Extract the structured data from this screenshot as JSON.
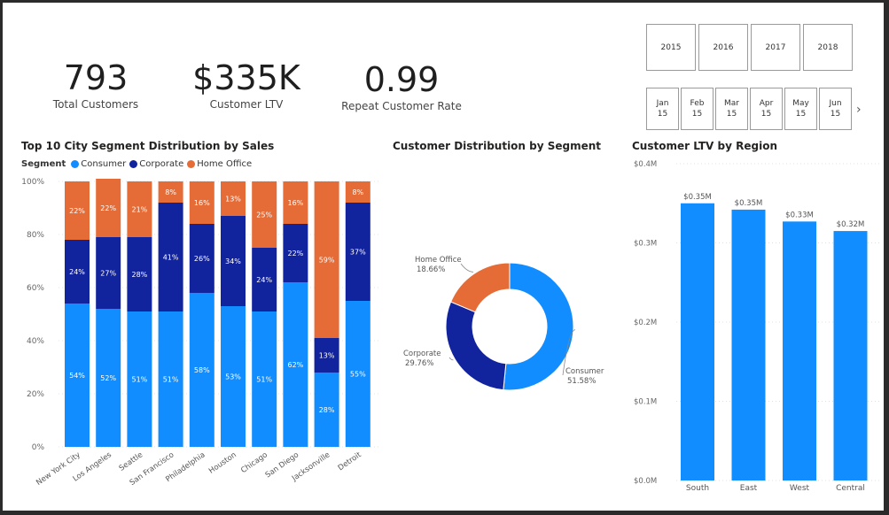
{
  "kpis": [
    {
      "value": "793",
      "label": "Total Customers"
    },
    {
      "value": "$335K",
      "label": "Customer LTV"
    },
    {
      "value": "0.99",
      "label": "Repeat Customer Rate"
    }
  ],
  "year_slicer": [
    "2015",
    "2016",
    "2017",
    "2018"
  ],
  "month_slicer": [
    {
      "month": "Jan",
      "year": "15"
    },
    {
      "month": "Feb",
      "year": "15"
    },
    {
      "month": "Mar",
      "year": "15"
    },
    {
      "month": "Apr",
      "year": "15"
    },
    {
      "month": "May",
      "year": "15"
    },
    {
      "month": "Jun",
      "year": "15"
    }
  ],
  "month_next_icon": "chevron-right-icon",
  "colors": {
    "consumer": "#118DFF",
    "corporate": "#12239E",
    "home_office": "#E66C37",
    "ltv_bar": "#118DFF"
  },
  "chart_data": [
    {
      "type": "bar",
      "stacking": "percent",
      "title": "Top 10 City Segment Distribution by Sales",
      "legend_title": "Segment",
      "legend_position": "top-left",
      "categories": [
        "New York City",
        "Los Angeles",
        "Seattle",
        "San Francisco",
        "Philadelphia",
        "Houston",
        "Chicago",
        "San Diego",
        "Jacksonville",
        "Detroit"
      ],
      "series": [
        {
          "name": "Consumer",
          "values": [
            54,
            52,
            51,
            51,
            58,
            53,
            51,
            62,
            28,
            55
          ]
        },
        {
          "name": "Corporate",
          "values": [
            24,
            27,
            28,
            41,
            26,
            34,
            24,
            22,
            13,
            37
          ]
        },
        {
          "name": "Home Office",
          "values": [
            22,
            22,
            21,
            8,
            16,
            13,
            25,
            16,
            59,
            8
          ]
        }
      ],
      "yticks": [
        "0%",
        "20%",
        "40%",
        "60%",
        "80%",
        "100%"
      ],
      "ylim": [
        0,
        100
      ]
    },
    {
      "type": "pie",
      "donut": true,
      "title": "Customer Distribution by Segment",
      "slices": [
        {
          "name": "Consumer",
          "value": 51.58,
          "label": "51.58%"
        },
        {
          "name": "Corporate",
          "value": 29.76,
          "label": "29.76%"
        },
        {
          "name": "Home Office",
          "value": 18.66,
          "label": "18.66%"
        }
      ]
    },
    {
      "type": "bar",
      "title": "Customer LTV by Region",
      "categories": [
        "South",
        "East",
        "West",
        "Central"
      ],
      "values": [
        0.35,
        0.342,
        0.327,
        0.315
      ],
      "data_labels": [
        "$0.35M",
        "$0.35M",
        "$0.33M",
        "$0.32M"
      ],
      "yticks": [
        "$0.0M",
        "$0.1M",
        "$0.2M",
        "$0.3M",
        "$0.4M"
      ],
      "ylim": [
        0,
        0.4
      ],
      "grid": true
    }
  ]
}
